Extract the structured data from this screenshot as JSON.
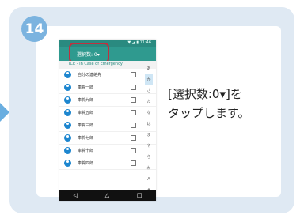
{
  "step_number": "14",
  "instruction_lines": [
    "[選択数:0▾]を",
    "タップします。"
  ],
  "phone": {
    "status_icons": "▼ ◢ ▮ 11:46",
    "select_button_label": "選択数: 0▾",
    "header_label": "ICE - In Case of Emergency",
    "contacts": [
      {
        "name": "自分の連絡先"
      },
      {
        "name": "車賀一郎"
      },
      {
        "name": "車賀九郎"
      },
      {
        "name": "車賀五郎"
      },
      {
        "name": "車賀三郎"
      },
      {
        "name": "車賀七郎"
      },
      {
        "name": "車賀十郎"
      },
      {
        "name": "車賀四郎"
      }
    ],
    "kana_index": [
      "あ",
      "か",
      "さ",
      "た",
      "な",
      "は",
      "ま",
      "や",
      "ら",
      "わ",
      "A",
      "#"
    ],
    "nav_icons": [
      "back-icon",
      "home-icon",
      "recents-icon"
    ],
    "nav_glyphs": [
      "◁",
      "△",
      "□"
    ]
  }
}
